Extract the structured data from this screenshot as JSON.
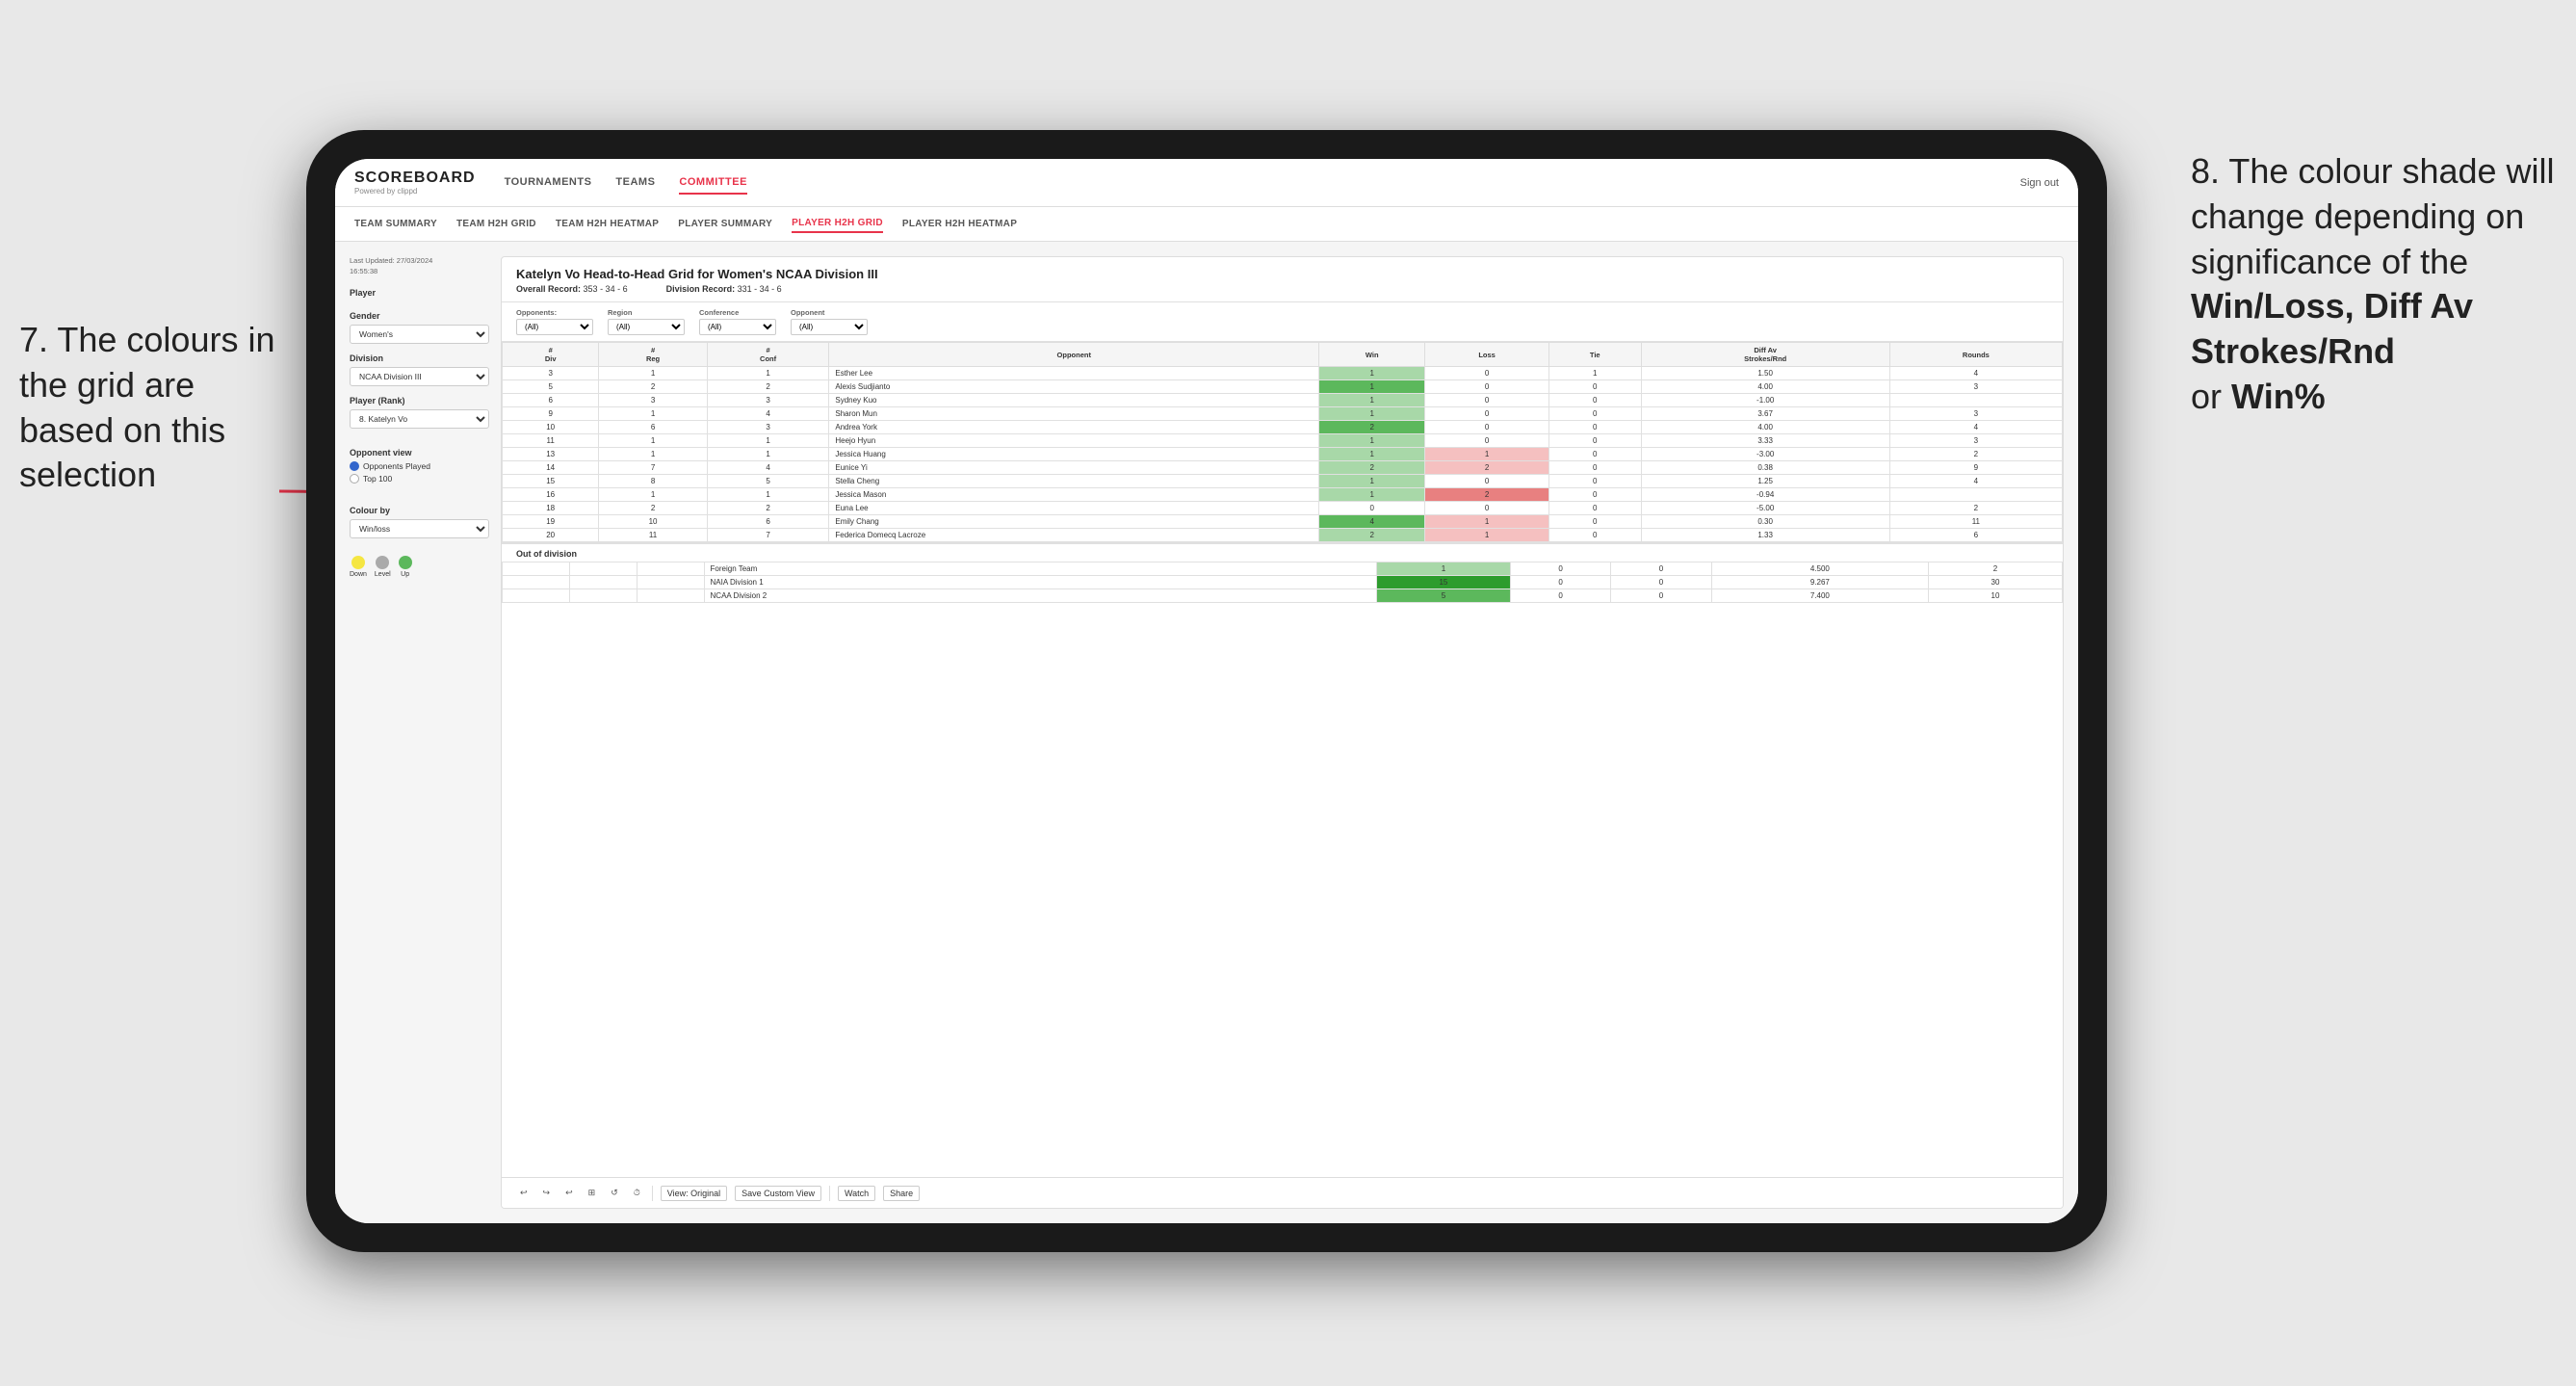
{
  "annotations": {
    "left_title": "7. The colours in the grid are based on this selection",
    "right_title": "8. The colour shade will change depending on significance of the",
    "right_bold1": "Win/Loss,",
    "right_bold2": "Diff Av Strokes/Rnd",
    "right_text": "or",
    "right_bold3": "Win%"
  },
  "header": {
    "logo": "SCOREBOARD",
    "logo_sub": "Powered by clippd",
    "nav_items": [
      "TOURNAMENTS",
      "TEAMS",
      "COMMITTEE"
    ],
    "active_nav": "COMMITTEE",
    "header_right": [
      "Sign out"
    ]
  },
  "sub_nav": {
    "items": [
      "TEAM SUMMARY",
      "TEAM H2H GRID",
      "TEAM H2H HEATMAP",
      "PLAYER SUMMARY",
      "PLAYER H2H GRID",
      "PLAYER H2H HEATMAP"
    ],
    "active": "PLAYER H2H GRID"
  },
  "left_panel": {
    "last_updated_label": "Last Updated: 27/03/2024",
    "last_updated_time": "16:55:38",
    "player_label": "Player",
    "gender_label": "Gender",
    "gender_value": "Women's",
    "division_label": "Division",
    "division_value": "NCAA Division III",
    "player_rank_label": "Player (Rank)",
    "player_rank_value": "8. Katelyn Vo",
    "opponent_view_label": "Opponent view",
    "radio_options": [
      {
        "label": "Opponents Played",
        "selected": true
      },
      {
        "label": "Top 100",
        "selected": false
      }
    ],
    "colour_by_label": "Colour by",
    "colour_by_value": "Win/loss",
    "legend": [
      {
        "color": "#f5e642",
        "label": "Down"
      },
      {
        "color": "#aaaaaa",
        "label": "Level"
      },
      {
        "color": "#5cb85c",
        "label": "Up"
      }
    ]
  },
  "grid": {
    "title": "Katelyn Vo Head-to-Head Grid for Women's NCAA Division III",
    "overall_record_label": "Overall Record:",
    "overall_record_value": "353 - 34 - 6",
    "division_record_label": "Division Record:",
    "division_record_value": "331 - 34 - 6",
    "filters": {
      "opponents_label": "Opponents:",
      "opponents_value": "(All)",
      "region_label": "Region",
      "region_value": "(All)",
      "conference_label": "Conference",
      "conference_value": "(All)",
      "opponent_label": "Opponent",
      "opponent_value": "(All)"
    },
    "col_headers": [
      "#\nDiv",
      "#\nReg",
      "#\nConf",
      "Opponent",
      "Win",
      "Loss",
      "Tie",
      "Diff Av\nStrokes/Rnd",
      "Rounds"
    ],
    "rows": [
      {
        "div": "3",
        "reg": "1",
        "conf": "1",
        "opponent": "Esther Lee",
        "win": "1",
        "loss": "0",
        "tie": "1",
        "diff": "1.50",
        "rounds": "4",
        "win_color": "win-light",
        "loss_color": "cell-empty",
        "tie_color": "cell-empty"
      },
      {
        "div": "5",
        "reg": "2",
        "conf": "2",
        "opponent": "Alexis Sudjianto",
        "win": "1",
        "loss": "0",
        "tie": "0",
        "diff": "4.00",
        "rounds": "3",
        "win_color": "win-medium",
        "loss_color": "cell-empty",
        "tie_color": "cell-empty"
      },
      {
        "div": "6",
        "reg": "3",
        "conf": "3",
        "opponent": "Sydney Kuo",
        "win": "1",
        "loss": "0",
        "tie": "0",
        "diff": "-1.00",
        "rounds": "",
        "win_color": "win-light",
        "loss_color": "cell-empty",
        "tie_color": "cell-empty"
      },
      {
        "div": "9",
        "reg": "1",
        "conf": "4",
        "opponent": "Sharon Mun",
        "win": "1",
        "loss": "0",
        "tie": "0",
        "diff": "3.67",
        "rounds": "3",
        "win_color": "win-light",
        "loss_color": "cell-empty",
        "tie_color": "cell-empty"
      },
      {
        "div": "10",
        "reg": "6",
        "conf": "3",
        "opponent": "Andrea York",
        "win": "2",
        "loss": "0",
        "tie": "0",
        "diff": "4.00",
        "rounds": "4",
        "win_color": "win-medium",
        "loss_color": "cell-empty",
        "tie_color": "cell-empty"
      },
      {
        "div": "11",
        "reg": "1",
        "conf": "1",
        "opponent": "Heejo Hyun",
        "win": "1",
        "loss": "0",
        "tie": "0",
        "diff": "3.33",
        "rounds": "3",
        "win_color": "win-light",
        "loss_color": "cell-empty",
        "tie_color": "cell-empty"
      },
      {
        "div": "13",
        "reg": "1",
        "conf": "1",
        "opponent": "Jessica Huang",
        "win": "1",
        "loss": "1",
        "tie": "0",
        "diff": "-3.00",
        "rounds": "2",
        "win_color": "win-light",
        "loss_color": "loss-light",
        "tie_color": "cell-empty"
      },
      {
        "div": "14",
        "reg": "7",
        "conf": "4",
        "opponent": "Eunice Yi",
        "win": "2",
        "loss": "2",
        "tie": "0",
        "diff": "0.38",
        "rounds": "9",
        "win_color": "win-light",
        "loss_color": "loss-light",
        "tie_color": "cell-empty"
      },
      {
        "div": "15",
        "reg": "8",
        "conf": "5",
        "opponent": "Stella Cheng",
        "win": "1",
        "loss": "0",
        "tie": "0",
        "diff": "1.25",
        "rounds": "4",
        "win_color": "win-light",
        "loss_color": "cell-empty",
        "tie_color": "cell-empty"
      },
      {
        "div": "16",
        "reg": "1",
        "conf": "1",
        "opponent": "Jessica Mason",
        "win": "1",
        "loss": "2",
        "tie": "0",
        "diff": "-0.94",
        "rounds": "",
        "win_color": "win-light",
        "loss_color": "loss-medium",
        "tie_color": "cell-empty"
      },
      {
        "div": "18",
        "reg": "2",
        "conf": "2",
        "opponent": "Euna Lee",
        "win": "0",
        "loss": "0",
        "tie": "0",
        "diff": "-5.00",
        "rounds": "2",
        "win_color": "cell-empty",
        "loss_color": "cell-empty",
        "tie_color": "cell-empty"
      },
      {
        "div": "19",
        "reg": "10",
        "conf": "6",
        "opponent": "Emily Chang",
        "win": "4",
        "loss": "1",
        "tie": "0",
        "diff": "0.30",
        "rounds": "11",
        "win_color": "win-medium",
        "loss_color": "loss-light",
        "tie_color": "cell-empty"
      },
      {
        "div": "20",
        "reg": "11",
        "conf": "7",
        "opponent": "Federica Domecq Lacroze",
        "win": "2",
        "loss": "1",
        "tie": "0",
        "diff": "1.33",
        "rounds": "6",
        "win_color": "win-light",
        "loss_color": "loss-light",
        "tie_color": "cell-empty"
      }
    ],
    "out_of_division_label": "Out of division",
    "out_of_division_rows": [
      {
        "opponent": "Foreign Team",
        "win": "1",
        "loss": "0",
        "tie": "0",
        "diff": "4.500",
        "rounds": "2",
        "win_color": "win-light"
      },
      {
        "opponent": "NAIA Division 1",
        "win": "15",
        "loss": "0",
        "tie": "0",
        "diff": "9.267",
        "rounds": "30",
        "win_color": "win-strong"
      },
      {
        "opponent": "NCAA Division 2",
        "win": "5",
        "loss": "0",
        "tie": "0",
        "diff": "7.400",
        "rounds": "10",
        "win_color": "win-medium"
      }
    ]
  },
  "toolbar": {
    "buttons": [
      "↩",
      "↪",
      "↩",
      "⊞",
      "↩·",
      "·",
      "⏱"
    ],
    "view_original": "View: Original",
    "save_custom": "Save Custom View",
    "watch": "Watch",
    "share": "Share"
  }
}
